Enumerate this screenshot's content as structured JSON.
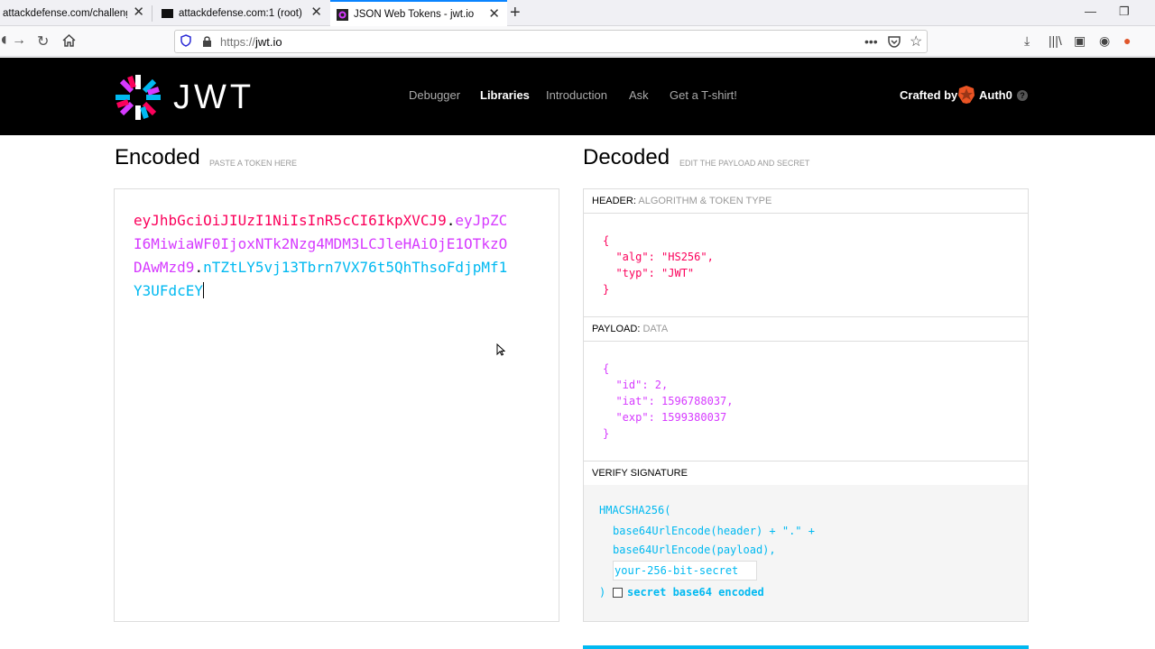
{
  "browser": {
    "tabs": [
      {
        "title": "attackdefense.com/challengedd"
      },
      {
        "title": "attackdefense.com:1 (root)"
      },
      {
        "title": "JSON Web Tokens - jwt.io"
      }
    ],
    "url_protocol": "https://",
    "url_host": "jwt.io"
  },
  "site": {
    "logo_text": "JWT",
    "nav": [
      "Debugger",
      "Libraries",
      "Introduction",
      "Ask",
      "Get a T-shirt!"
    ],
    "crafted_by": "Crafted by",
    "auth0": "Auth0",
    "help": "?"
  },
  "encoded": {
    "title": "Encoded",
    "subtitle": "PASTE A TOKEN HERE",
    "header_part": "eyJhbGciOiJIUzI1NiIsInR5cCI6IkpXVCJ9",
    "payload_part": "eyJpZCI6MiwiaWF0IjoxNTk2Nzg4MDM3LCJleHAiOjE1OTkzODAwMzd9",
    "signature_part": "nTZtLY5vj13Tbrn7VX76t5QhThsoFdjpMf1Y3UFdcEY",
    "dot": "."
  },
  "decoded": {
    "title": "Decoded",
    "subtitle": "EDIT THE PAYLOAD AND SECRET",
    "header_label": "HEADER:",
    "header_hint": "ALGORITHM & TOKEN TYPE",
    "header_json": [
      "{",
      "  \"alg\": \"HS256\",",
      "  \"typ\": \"JWT\"",
      "}"
    ],
    "payload_label": "PAYLOAD:",
    "payload_hint": "DATA",
    "payload_json": [
      "{",
      "  \"id\": 2,",
      "  \"iat\": 1596788037,",
      "  \"exp\": 1599380037",
      "}"
    ],
    "verify_label": "VERIFY SIGNATURE",
    "sig_line1": "HMACSHA256(",
    "sig_line2": "base64UrlEncode(header) + \".\" +",
    "sig_line3": "base64UrlEncode(payload),",
    "secret_value": "your-256-bit-secret",
    "sig_close": ")",
    "checkbox_label": "secret base64 encoded"
  },
  "colors": {
    "header": "#fb015b",
    "payload": "#d63aff",
    "signature": "#00b9f1"
  }
}
